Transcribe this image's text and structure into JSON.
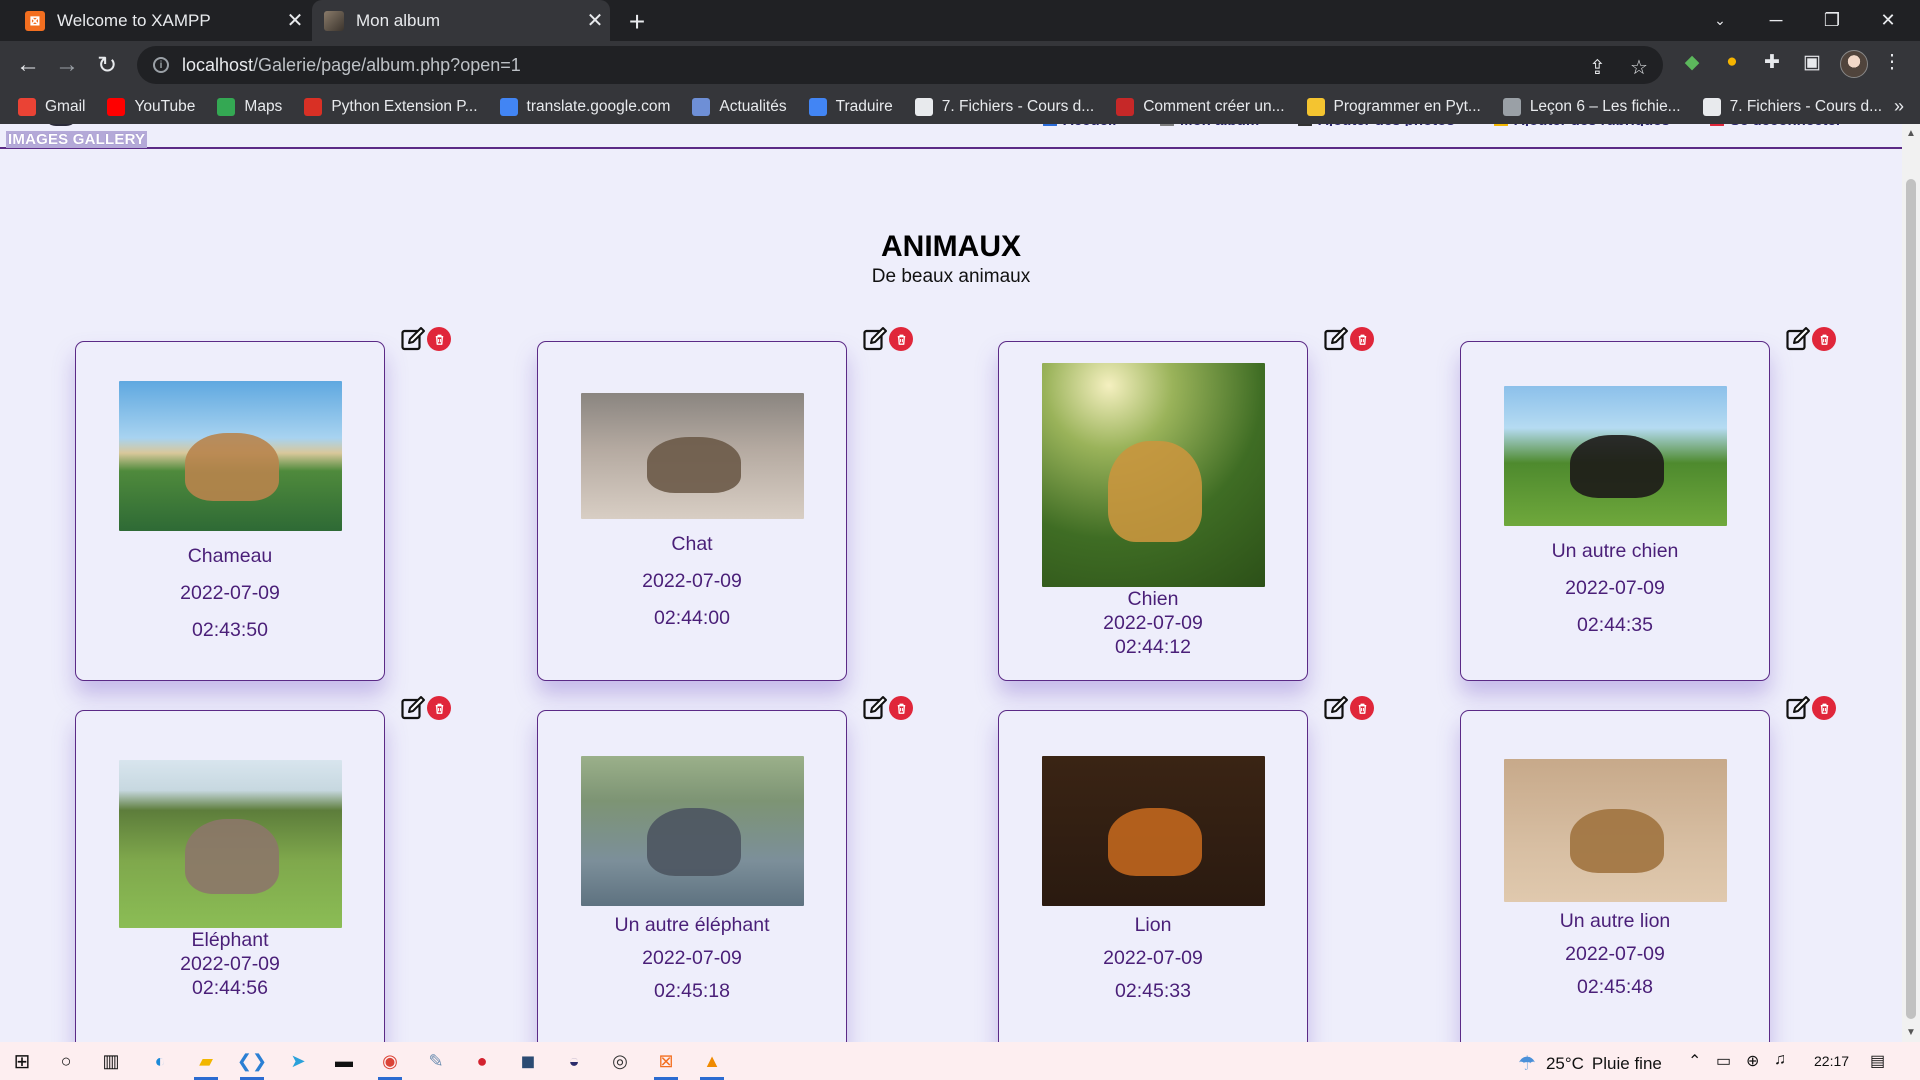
{
  "browser": {
    "tabs": [
      {
        "title": "Welcome to XAMPP",
        "favicon": "xampp-icon"
      },
      {
        "title": "Mon album",
        "favicon": "album-photo-icon"
      }
    ],
    "url_host": "localhost",
    "url_path": "/Galerie/page/album.php?open=1",
    "bookmarks": [
      {
        "label": "Gmail",
        "icon": "gmail-icon",
        "color": "#ea4335"
      },
      {
        "label": "YouTube",
        "icon": "youtube-icon",
        "color": "#ff0000"
      },
      {
        "label": "Maps",
        "icon": "maps-icon",
        "color": "#34a853"
      },
      {
        "label": "Python Extension P...",
        "icon": "python-ext-icon",
        "color": "#d93025"
      },
      {
        "label": "translate.google.com",
        "icon": "translate-icon",
        "color": "#4285f4"
      },
      {
        "label": "Actualités",
        "icon": "news-icon",
        "color": "#6e8fd6"
      },
      {
        "label": "Traduire",
        "icon": "translate-icon",
        "color": "#4285f4"
      },
      {
        "label": "7. Fichiers - Cours d...",
        "icon": "course-icon",
        "color": "#e8eaed"
      },
      {
        "label": "Comment créer un...",
        "icon": "web-icon",
        "color": "#c62828"
      },
      {
        "label": "Programmer en Pyt...",
        "icon": "python-icon",
        "color": "#f4c430"
      },
      {
        "label": "Leçon 6 – Les fichie...",
        "icon": "globe-icon",
        "color": "#9aa0a6"
      },
      {
        "label": "7. Fichiers - Cours d...",
        "icon": "course-icon",
        "color": "#e8eaed"
      }
    ]
  },
  "site": {
    "brand": "IMAGES GALLERY",
    "nav": [
      {
        "label": "Accueil",
        "icon": "home-icon",
        "color": "#2a6bd8"
      },
      {
        "label": "Mon album",
        "icon": "album-icon",
        "color": "#7d7d7d"
      },
      {
        "label": "Ajouter des photos",
        "icon": "add-photo-icon",
        "color": "#333333"
      },
      {
        "label": "Ajouter des rubriques",
        "icon": "folder-icon",
        "color": "#f2b600"
      },
      {
        "label": "Se déconnecter",
        "icon": "logout-icon",
        "color": "#e0263a"
      }
    ]
  },
  "album": {
    "title": "ANIMAUX",
    "description": "De beaux animaux",
    "photos": [
      {
        "name": "Chameau",
        "date": "2022-07-09",
        "time": "02:43:50",
        "image": "camel-photo"
      },
      {
        "name": "Chat",
        "date": "2022-07-09",
        "time": "02:44:00",
        "image": "cat-photo"
      },
      {
        "name": "Chien",
        "date": "2022-07-09",
        "time": "02:44:12",
        "image": "golden-retriever-photo"
      },
      {
        "name": "Un autre chien",
        "date": "2022-07-09",
        "time": "02:44:35",
        "image": "bernese-dog-photo"
      },
      {
        "name": "Eléphant",
        "date": "2022-07-09",
        "time": "02:44:56",
        "image": "elephant-photo"
      },
      {
        "name": "Un autre éléphant",
        "date": "2022-07-09",
        "time": "02:45:18",
        "image": "elephant-water-photo"
      },
      {
        "name": "Lion",
        "date": "2022-07-09",
        "time": "02:45:33",
        "image": "lion-roaring-photo"
      },
      {
        "name": "Un autre lion",
        "date": "2022-07-09",
        "time": "02:45:48",
        "image": "lion-walking-photo"
      }
    ]
  },
  "taskbar": {
    "temperature": "25°C",
    "weather": "Pluie fine",
    "time": "22:17"
  },
  "colors": {
    "page_bg": "#eeeefb",
    "accent": "#5b2a86",
    "caption": "#4a1f78",
    "delete": "#e0263a"
  }
}
